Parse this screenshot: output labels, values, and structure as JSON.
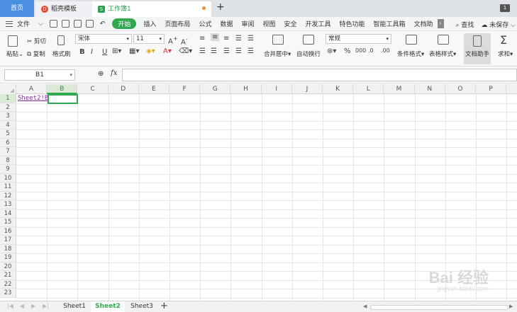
{
  "tabs": {
    "home": "首页",
    "docer": "稻壳模板",
    "workbook": "工作簿1",
    "add": "+",
    "window_count": "1"
  },
  "menu": {
    "file": "文件",
    "items": [
      "开始",
      "插入",
      "页面布局",
      "公式",
      "数据",
      "审阅",
      "视图",
      "安全",
      "开发工具",
      "特色功能",
      "智能工具箱",
      "文档助"
    ],
    "search": "查找",
    "unsaved": "未保存"
  },
  "ribbon": {
    "paste": "粘贴",
    "cut": "剪切",
    "copy": "复制",
    "format_painter": "格式刷",
    "font_name": "宋体",
    "font_size": "11",
    "merge_center": "合并居中",
    "wrap_text": "自动换行",
    "number_format": "常规",
    "cond_format": "条件格式",
    "table_style": "表格样式",
    "doc_helper": "文档助手",
    "sum": "求和"
  },
  "formula_bar": {
    "name_box": "B1",
    "fx": "fx",
    "formula": ""
  },
  "grid": {
    "columns": [
      "A",
      "B",
      "C",
      "D",
      "E",
      "F",
      "G",
      "H",
      "I",
      "J",
      "K",
      "L",
      "M",
      "N",
      "O",
      "P"
    ],
    "rows": [
      "1",
      "2",
      "3",
      "4",
      "5",
      "6",
      "7",
      "8",
      "9",
      "10",
      "11",
      "12",
      "13",
      "14",
      "15",
      "16",
      "17",
      "18",
      "19",
      "20",
      "21",
      "22",
      "23"
    ],
    "selected_column": "B",
    "selected_row": "1",
    "a1_value": "Sheet2!B"
  },
  "sheets": {
    "tabs": [
      "Sheet1",
      "Sheet2",
      "Sheet3"
    ],
    "active": "Sheet2",
    "add": "+"
  },
  "watermark": {
    "logo": "Bai 经验",
    "url": "jingyan.baidu.com"
  }
}
